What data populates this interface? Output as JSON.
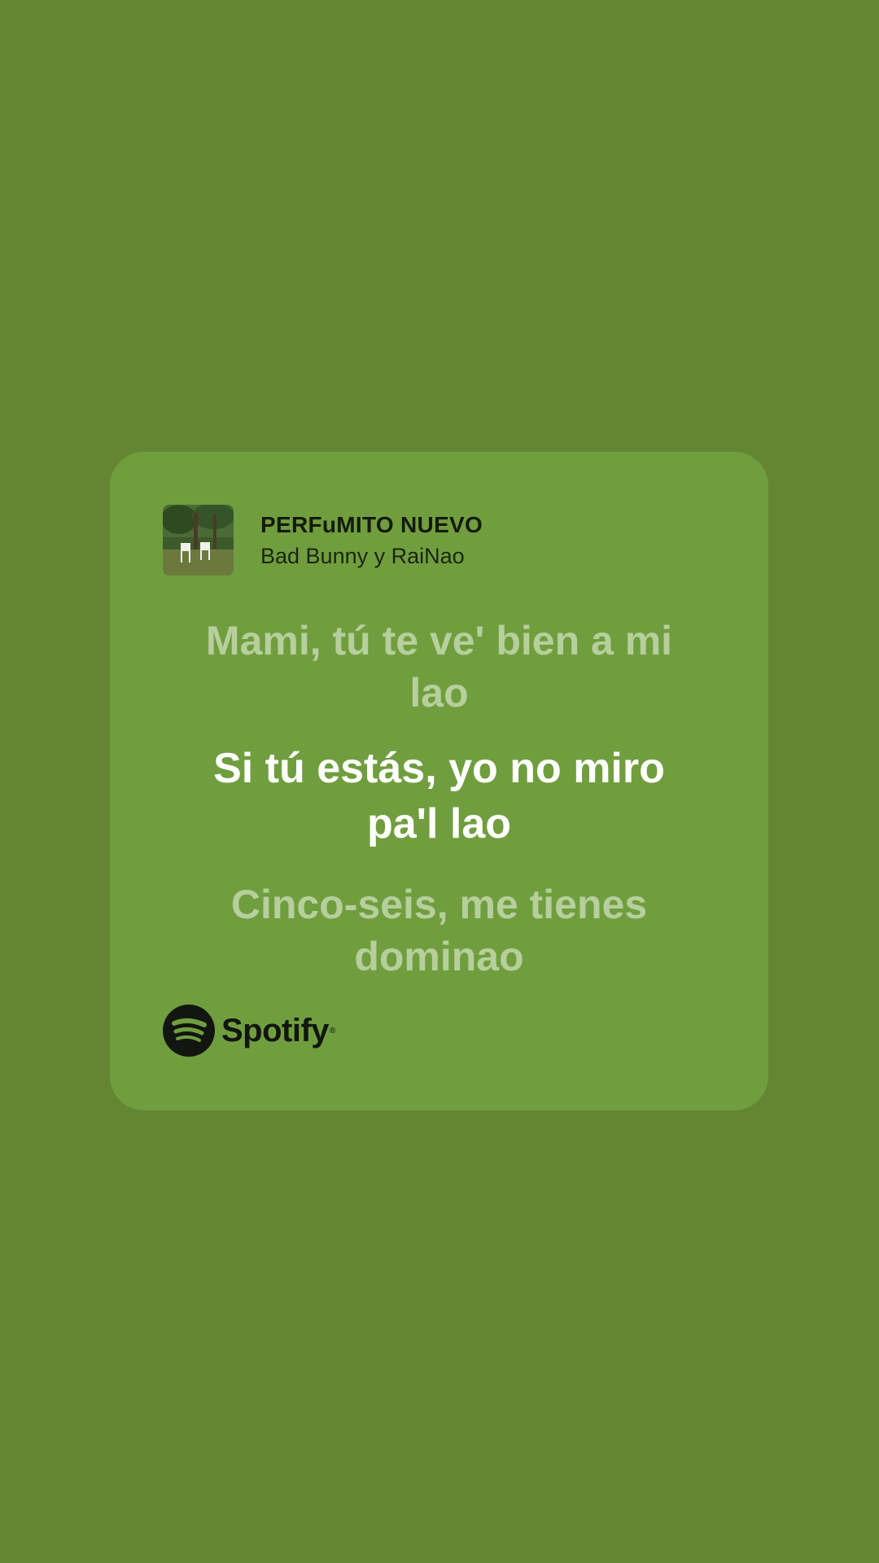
{
  "track": {
    "title": "PERFuMITO NUEVO",
    "artist": "Bad Bunny y RaiNao"
  },
  "lyrics": {
    "previous": "Mami, tú te ve' bien a mi lao",
    "current": "Si tú estás, yo no miro pa'l lao",
    "next": "Cinco-seis, me tienes dominao"
  },
  "brand": {
    "name": "Spotify",
    "trademark": "®"
  },
  "colors": {
    "background": "#648633",
    "card": "#709e3e",
    "current_lyric": "#ffffff",
    "dim_lyric": "#b6cf9c"
  },
  "icons": {
    "album_cover": "album-cover-image",
    "brand_logo": "spotify-logo-icon"
  }
}
